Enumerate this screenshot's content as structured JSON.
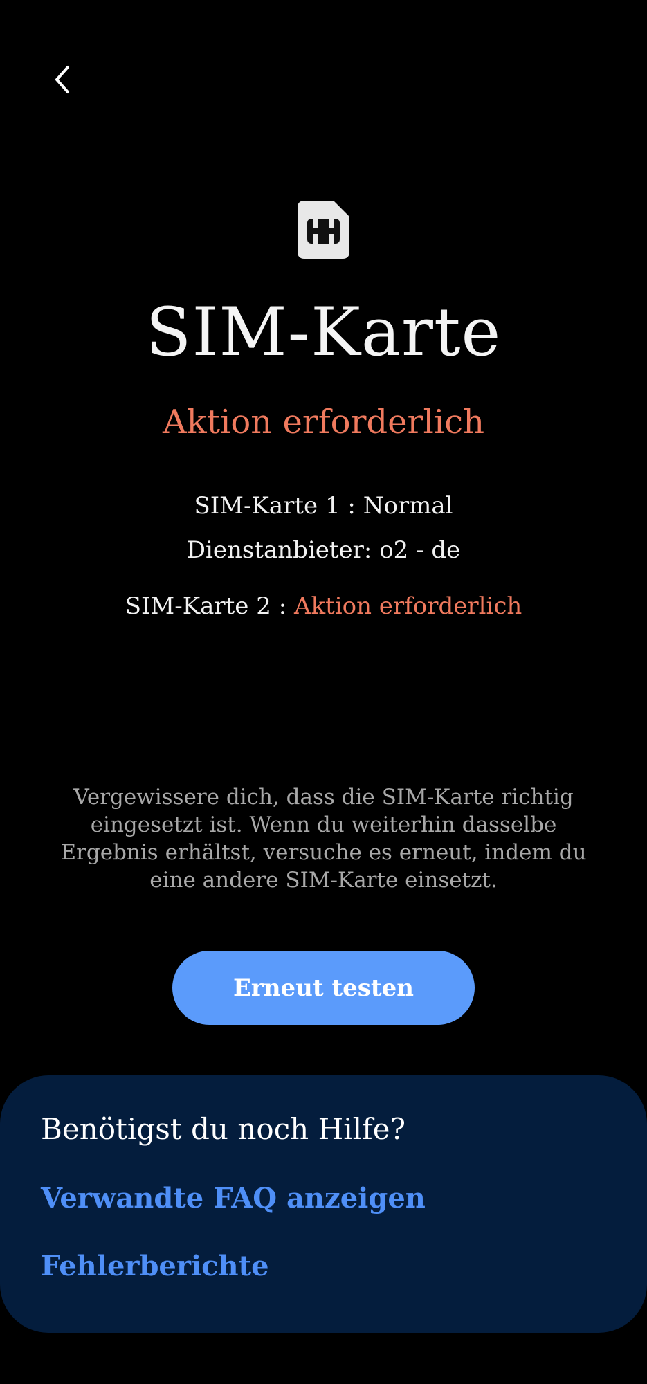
{
  "header": {
    "back_icon": "chevron-left-icon"
  },
  "hero": {
    "icon": "sim-card-icon",
    "title": "SIM-Karte",
    "status": "Aktion erforderlich"
  },
  "sim_info": {
    "sim1_label": "SIM-Karte 1 : ",
    "sim1_status": "Normal",
    "provider_label": "Dienstanbieter: ",
    "provider_value": "o2 - de",
    "sim2_label": "SIM-Karte 2 : ",
    "sim2_status": "Aktion erforderlich"
  },
  "description": "Vergewissere dich, dass die SIM-Karte richtig eingesetzt ist. Wenn du weiterhin dasselbe Ergebnis erhältst, versuche es erneut, indem du eine andere SIM-Karte einsetzt.",
  "actions": {
    "retry_label": "Erneut testen"
  },
  "help": {
    "title": "Benötigst du noch Hilfe?",
    "faq_link": "Verwandte FAQ anzeigen",
    "report_link": "Fehlerberichte"
  },
  "colors": {
    "background": "#000000",
    "warning": "#f07a5e",
    "button": "#5b9bfb",
    "card": "#041d3d",
    "link": "#4f8ff7"
  }
}
